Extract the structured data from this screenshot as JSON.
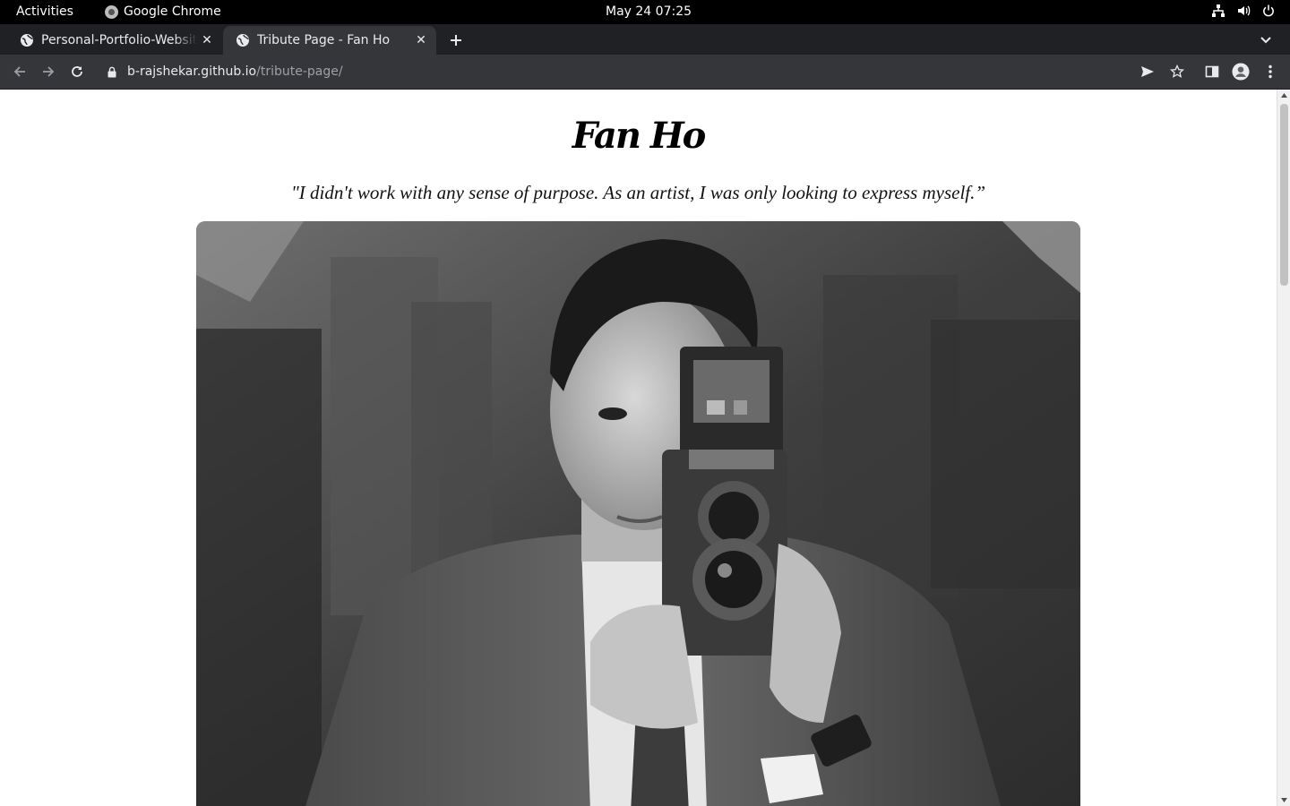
{
  "system_bar": {
    "activities": "Activities",
    "app_name": "Google Chrome",
    "clock": "May 24  07:25",
    "tray_icons": [
      "network-icon",
      "volume-icon",
      "power-icon"
    ]
  },
  "tabs": [
    {
      "title": "Personal-Portfolio-Website",
      "active": false
    },
    {
      "title": "Tribute Page - Fan Ho",
      "active": true
    }
  ],
  "address_bar": {
    "host": "b-rajshekar.github.io",
    "path": "/tribute-page/"
  },
  "page": {
    "title": "Fan Ho",
    "quote": "\"I didn't work with any sense of purpose. As an artist, I was only looking to express myself.”",
    "image_alt": "Black and white photo of Fan Ho holding a twin-lens camera"
  },
  "colors": {
    "topbar": "#000000",
    "tabstrip": "#202124",
    "toolbar": "#35363a",
    "text_light": "#e8eaed",
    "url_path": "#9aa0a6",
    "page_bg": "#ffffff"
  }
}
